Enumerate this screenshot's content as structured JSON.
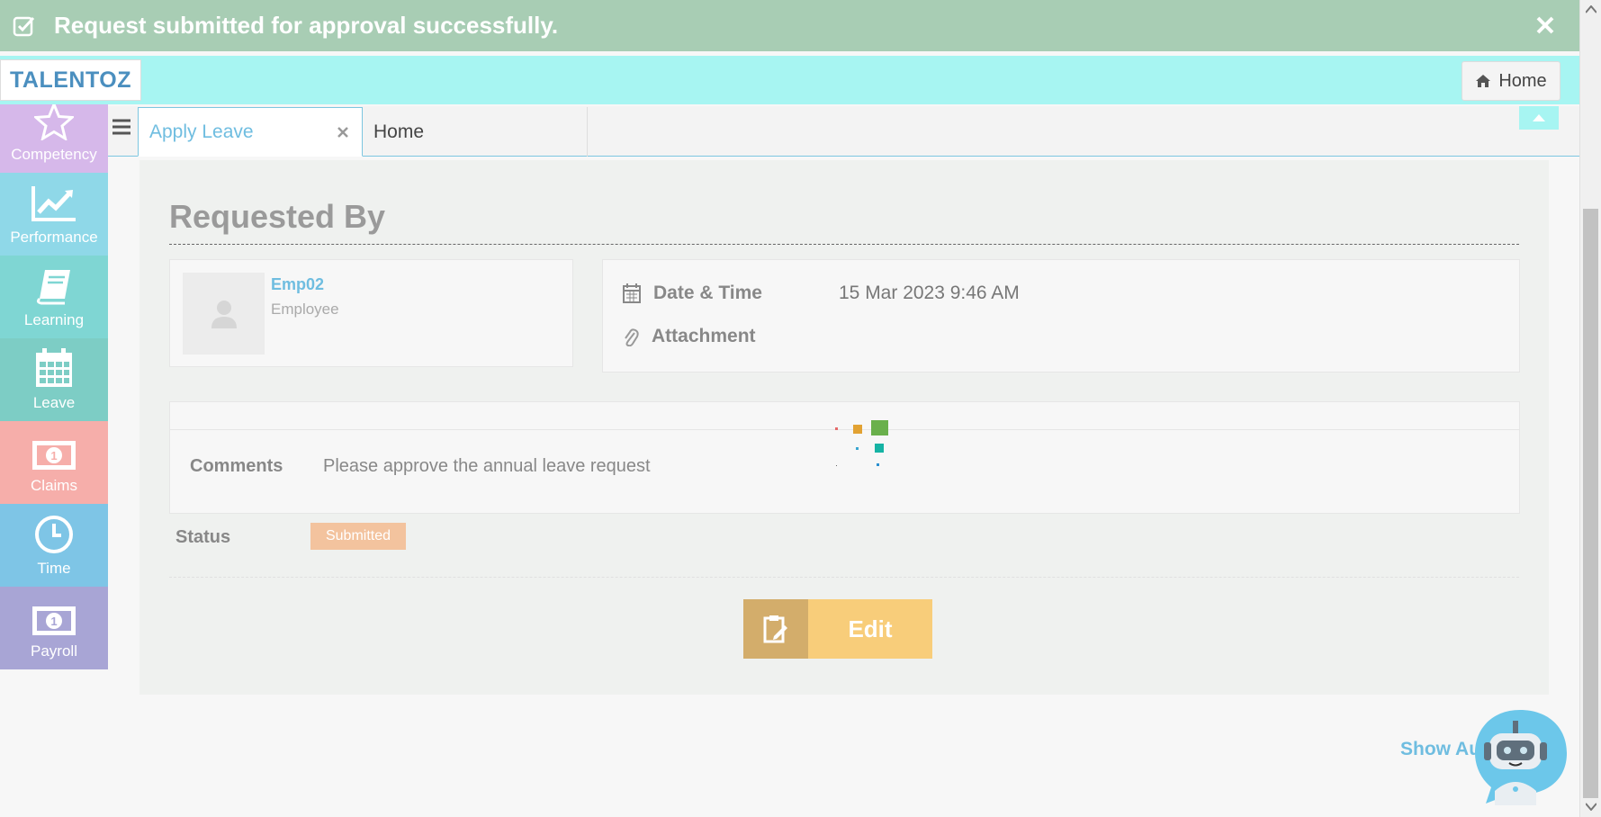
{
  "toast": {
    "message": "Request submitted for approval successfully."
  },
  "header": {
    "logo_text": "TALENTOZ",
    "home_label": "Home"
  },
  "sidebar": {
    "items": [
      {
        "label": "Competency",
        "icon": "star-icon",
        "color": "#d6b8ea"
      },
      {
        "label": "Performance",
        "icon": "chart-line-icon",
        "color": "#8fd8e8"
      },
      {
        "label": "Learning",
        "icon": "book-icon",
        "color": "#7fd6d3"
      },
      {
        "label": "Leave",
        "icon": "calendar-icon",
        "color": "#7dcdc5"
      },
      {
        "label": "Claims",
        "icon": "money-icon",
        "color": "#f6aeaa"
      },
      {
        "label": "Time",
        "icon": "clock-icon",
        "color": "#7ec5e6"
      },
      {
        "label": "Payroll",
        "icon": "money-icon",
        "color": "#a8a5d5"
      }
    ]
  },
  "tabs": [
    {
      "label": "Apply Leave",
      "active": true
    },
    {
      "label": "Home",
      "active": false
    }
  ],
  "main": {
    "section_title": "Requested By",
    "employee": {
      "name": "Emp02",
      "role": "Employee"
    },
    "date_time_label": "Date & Time",
    "date_time_value": "15 Mar 2023 9:46 AM",
    "attachment_label": "Attachment",
    "comments_label": "Comments",
    "comments_value": "Please approve the annual leave request",
    "status_label": "Status",
    "status_value": "Submitted",
    "status_color": "#f3c39e",
    "edit_label": "Edit"
  },
  "footer": {
    "show_audit_label": "Show Audit"
  },
  "colors": {
    "accent": "#6fbde0",
    "header_bg": "#a7f5f2",
    "toast_bg": "#a8cdb4"
  }
}
